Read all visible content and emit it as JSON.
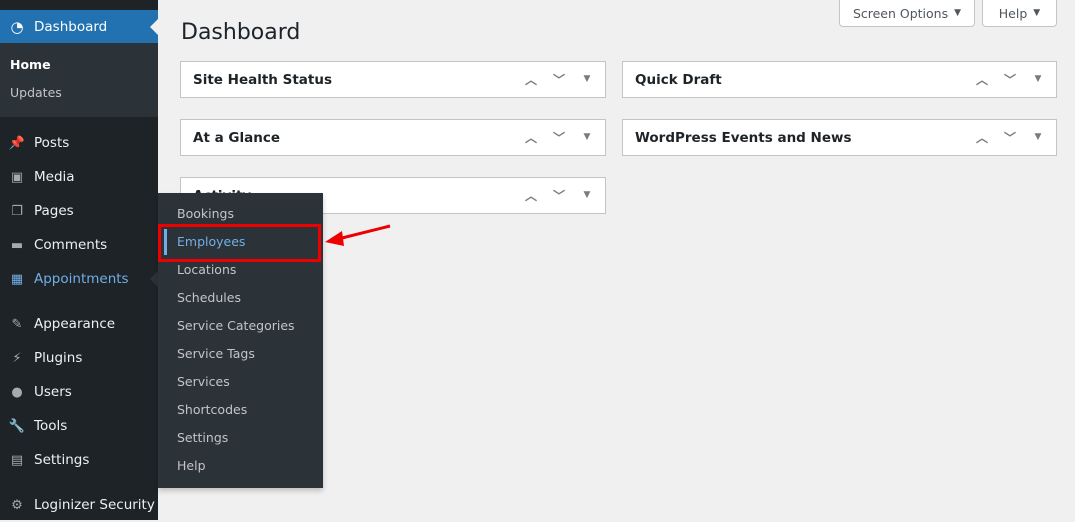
{
  "sidebar": {
    "dashboard": {
      "label": "Dashboard",
      "icon": "dashboard-icon"
    },
    "submenu": [
      "Home",
      "Updates"
    ],
    "items": [
      {
        "label": "Posts",
        "icon": "pin-icon"
      },
      {
        "label": "Media",
        "icon": "media-icon"
      },
      {
        "label": "Pages",
        "icon": "pages-icon"
      },
      {
        "label": "Comments",
        "icon": "comment-icon"
      },
      {
        "label": "Appointments",
        "icon": "calendar-icon"
      },
      {
        "label": "Appearance",
        "icon": "brush-icon"
      },
      {
        "label": "Plugins",
        "icon": "plugin-icon"
      },
      {
        "label": "Users",
        "icon": "user-icon"
      },
      {
        "label": "Tools",
        "icon": "wrench-icon"
      },
      {
        "label": "Settings",
        "icon": "settings-icon"
      },
      {
        "label": "Loginizer Security",
        "icon": "gear-icon"
      }
    ]
  },
  "flyout": [
    "Bookings",
    "Employees",
    "Locations",
    "Schedules",
    "Service Categories",
    "Service Tags",
    "Services",
    "Shortcodes",
    "Settings",
    "Help"
  ],
  "header": {
    "title": "Dashboard",
    "screen_options": "Screen Options",
    "help": "Help"
  },
  "panels": {
    "left": [
      "Site Health Status",
      "At a Glance",
      "Activity"
    ],
    "right": [
      "Quick Draft",
      "WordPress Events and News"
    ]
  },
  "colors": {
    "accent": "#2271b1",
    "highlight": "#ff0000",
    "sidebar": "#1d2327"
  }
}
